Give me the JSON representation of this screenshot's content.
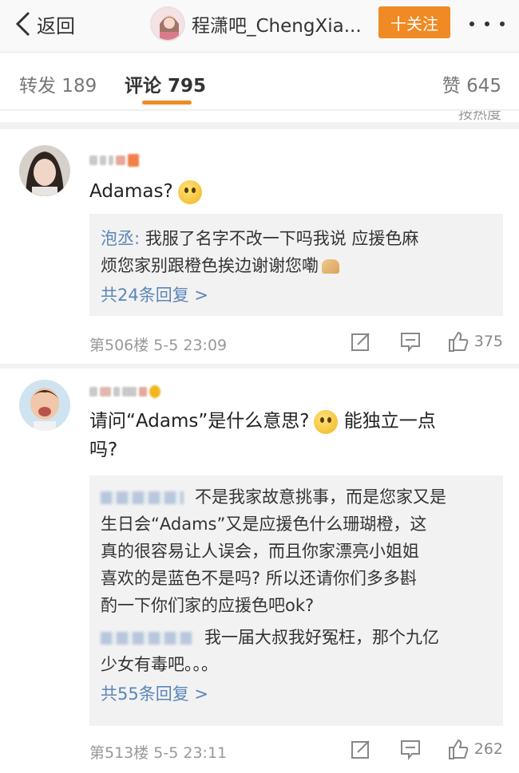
{
  "nav": {
    "back_label": "返回",
    "title": "程潇吧_ChengXia...",
    "follow_label": "十关注",
    "more_icon": "more-dots-icon"
  },
  "tabs": {
    "repost": "转发 189",
    "comment": "评论 795",
    "like": "赞 645"
  },
  "sort_label": "按热度",
  "comments": [
    {
      "text": "Adamas?",
      "reply_preview_name": "泡丞:",
      "reply_preview_line1": " 我服了名字不改一下吗我说 应援色麻",
      "reply_preview_line2": "烦您家别跟橙色挨边谢谢您嘞",
      "reply_count": "共24条回复 >",
      "floor": "第506楼 5-5 23:09",
      "likes": "375"
    },
    {
      "text_line1": "请问“Adams”是什么意思?",
      "text_line1b": " 能独立一点",
      "text_line2": "吗?",
      "reply1_line1": "不是我家故意挑事，而是您家又是",
      "reply1_line2": "生日会“Adams”又是应援色什么珊瑚橙，这",
      "reply1_line3": "真的很容易让人误会，而且你家漂亮小姐姐",
      "reply1_line4": "喜欢的是蓝色不是吗? 所以还请你们多多斟",
      "reply1_line5": "酌一下你们家的应援色吧ok?",
      "reply2_line1": "我一届大叔我好冤枉，那个九亿",
      "reply2_line2": "少女有毒吧。。。",
      "reply_count": "共55条回复 >",
      "floor": "第513楼 5-5 23:11",
      "likes": "262"
    }
  ],
  "colors": {
    "accent": "#f08a24",
    "link": "#5b86b8"
  }
}
